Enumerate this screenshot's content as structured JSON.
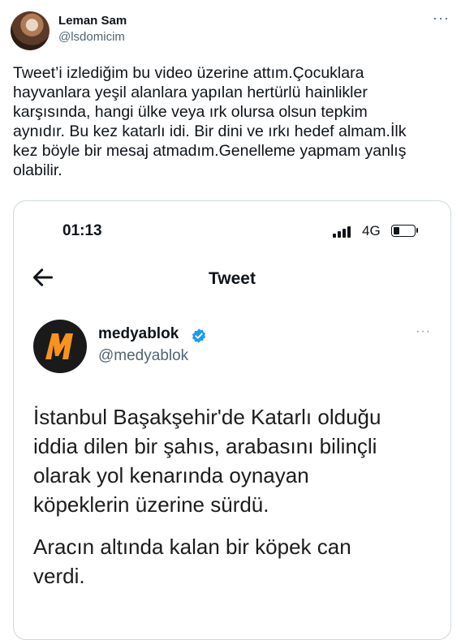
{
  "author": {
    "name": "Leman Sam",
    "handle": "@lsdomicim"
  },
  "tweet": {
    "text": "Tweet’i izlediğim bu video üzerine attım.Çocuklara\nhayvanlara yeşil alanlara yapılan hertürlü hainlikler\nkarşısında, hangi ülke veya ırk olursa olsun tepkim\naynıdır. Bu kez katarlı idi. Bir dini ve ırkı hedef almam.İlk\nkez böyle bir mesaj atmadım.Genelleme yapmam yanlış\nolabilir."
  },
  "media": {
    "status_bar": {
      "time": "01:13",
      "network": "4G",
      "battery_level": 0.3
    },
    "header_title": "Tweet",
    "embedded_tweet": {
      "name": "medyablok",
      "handle": "@medyablok",
      "logo_letter": "M",
      "paragraph_1": "İstanbul Başakşehir'de Katarlı olduğu\niddia dilen bir şahıs, arabasını bilinçli\nolarak yol kenarında oynayan\nköpeklerin üzerine sürdü.",
      "paragraph_2": "Aracın altında kalan bir köpek can\nverdi."
    }
  },
  "icons": {
    "more": "more-horizontal-icon",
    "back": "back-arrow-icon",
    "verified": "verified-badge-icon"
  },
  "colors": {
    "text": "#0f1419",
    "secondary": "#536471",
    "verified_blue": "#1d9bf0",
    "logo_orange": "#f7931e"
  }
}
